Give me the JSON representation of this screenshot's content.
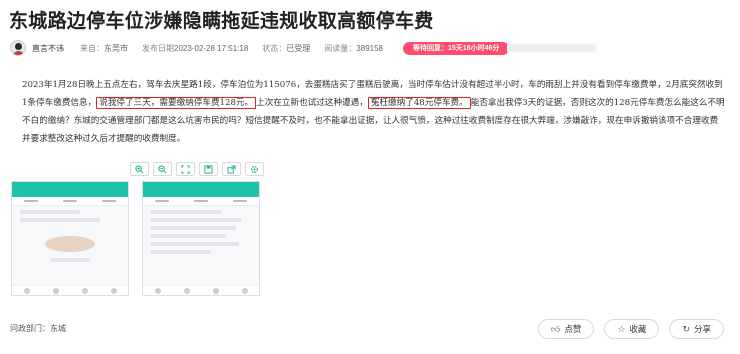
{
  "article": {
    "title": "东城路边停车位涉嫌隐瞒拖延违规收取高额停车费",
    "author": "直言不讳",
    "location_label": "来自：",
    "location_value": "东莞市",
    "date_label": "发布日期",
    "date_value": "2023-02-28 17:51:18",
    "status_label": "状态：",
    "status_value": "已受理",
    "views_label": "阅读量：",
    "views_value": "389158",
    "wait_badge": "等待回复：15天18小时46分"
  },
  "content": {
    "seg1": "2023年1月28日晚上五点左右，驾车去庆星路1段，停车泊位为115076，去蛋糕店买了蛋糕后驶离，当时停车估计没有超过半小时，车的雨刮上并没有看到停车缴费单，2月底突然收到1条停车缴费信息，",
    "hl1": "说我停了三天，需要缴纳停车费128元。",
    "seg2": "上次在立新也试过这种遭遇，",
    "hl2": "冤枉缴纳了48元停车费。",
    "seg3": "能否拿出我停3天的证据，否则这次的128元停车费怎么能这么不明不白的缴纳？东城的交通管理部门都是这么坑害市民的吗？短信提醒不及时，也不能拿出证据，让人很气愤，这种过往收费制度存在很大弊端，涉嫌敲诈，现在申诉撤销该项不合理收费并要求整改这种过久后才提醒的收费制度。"
  },
  "image_toolbar": [
    "search-plus-icon",
    "search-minus-icon",
    "expand-icon",
    "save-icon",
    "external-link-icon",
    "settings-icon"
  ],
  "footer": {
    "dept_label": "问政部门：",
    "dept_value": "东城",
    "like_label": "点赞",
    "collect_label": "收藏",
    "share_label": "分享"
  },
  "colors": {
    "highlight_border": "#e02424",
    "badge_bg": "#ff4d6d",
    "app_teal": "#1fc4a8"
  }
}
